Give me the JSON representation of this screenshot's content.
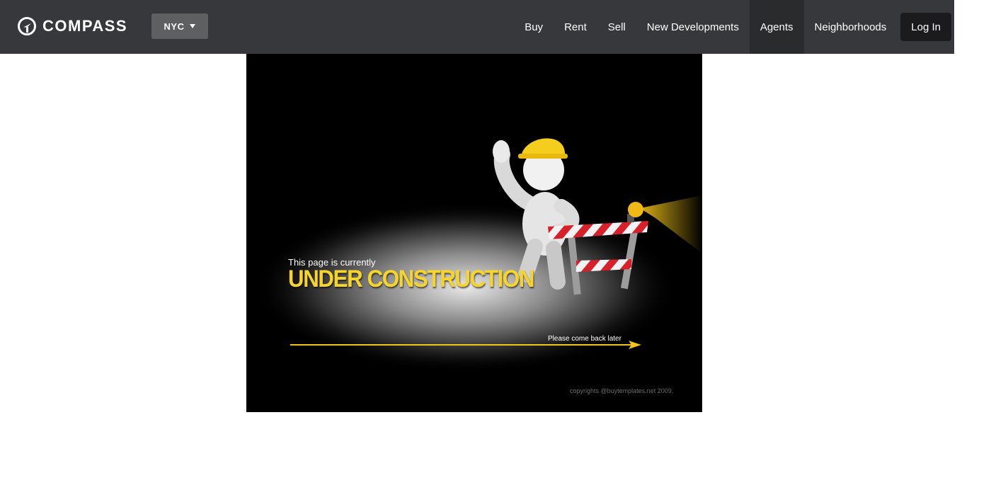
{
  "header": {
    "logo_text": "COMPASS",
    "city_selector": "NYC",
    "nav_items": [
      "Buy",
      "Rent",
      "Sell",
      "New Developments",
      "Agents",
      "Neighborhoods"
    ],
    "active_item": "Agents",
    "login_label": "Log In"
  },
  "construction": {
    "subtitle": "This page is currently",
    "title": "UNDER CONSTRUCTION",
    "back_message": "Please come back later",
    "copyright": "copyrights @buytemplates.net 2009."
  },
  "colors": {
    "navbar": "#37383b",
    "nav_active": "#2a2b2d",
    "login_button": "#1b1b1d",
    "city_selector": "#5e5f61",
    "accent_yellow": "#f6d42a"
  }
}
